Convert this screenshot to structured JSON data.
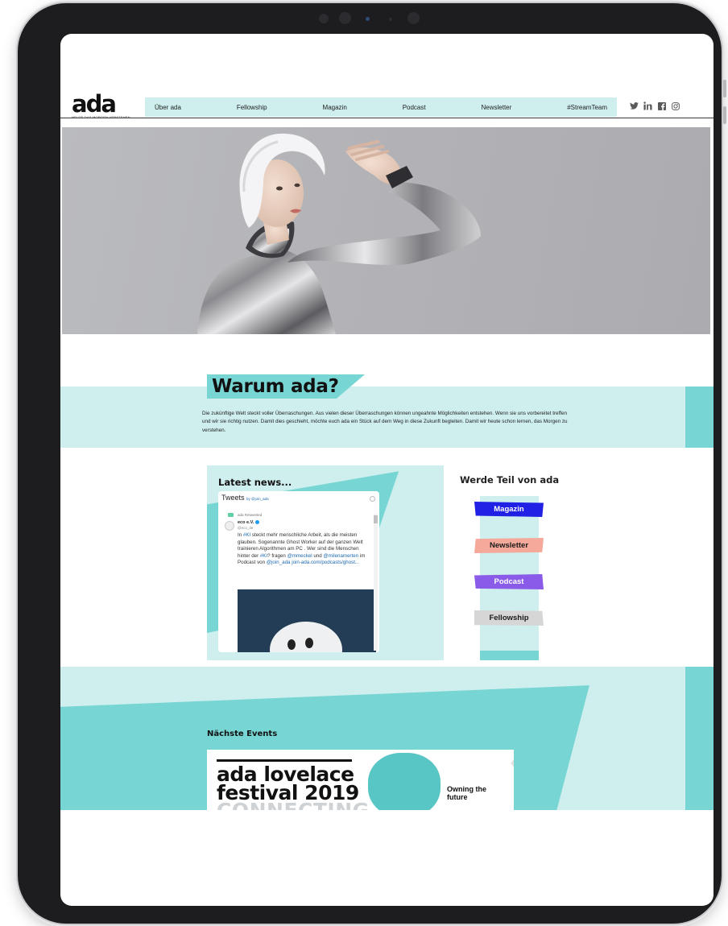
{
  "header": {
    "logo_word": "ada",
    "logo_tagline": "HEUTE DAS MORGEN VERSTEHEN",
    "nav": [
      "Über ada",
      "Fellowship",
      "Magazin",
      "Podcast",
      "Newsletter",
      "#StreamTeam"
    ],
    "social_icons": [
      "twitter-icon",
      "linkedin-icon",
      "facebook-icon",
      "instagram-icon"
    ]
  },
  "why": {
    "title": "Warum ada?",
    "text": "Die zukünftige Welt steckt voller Überraschungen. Aus vielen dieser Überraschungen können ungeahnte Möglichkeiten entstehen. Wenn sie uns vorbereitet treffen und wir sie richtig nutzen. Damit dies geschieht, möchte euch ada ein Stück auf dem Weg in diese Zukunft begleiten. Damit wir heute schon lernen, das Morgen zu verstehen."
  },
  "news": {
    "title": "Latest news...",
    "widget": {
      "heading": "Tweets",
      "by": "by @join_ada",
      "retweeted": "ada Retweeted",
      "author": "eco e.V.",
      "handle": "@eco_de",
      "body_parts": [
        {
          "t": "In ",
          "link": false
        },
        {
          "t": "#KI",
          "link": true
        },
        {
          "t": " steckt mehr menschliche Arbeit, als die meisten glauben. Sogenannte Ghost Worker auf der ganzen Welt trainieren Algorithmen am PC . Wer sind die Menschen hinter der ",
          "link": false
        },
        {
          "t": "#KI",
          "link": true
        },
        {
          "t": "? fragen ",
          "link": false
        },
        {
          "t": "@mmeckel",
          "link": true
        },
        {
          "t": " und ",
          "link": false
        },
        {
          "t": "@milenamerten",
          "link": true
        },
        {
          "t": " im Podcast von ",
          "link": false
        },
        {
          "t": "@join_ada",
          "link": true
        },
        {
          "t": " ",
          "link": false
        },
        {
          "t": "join-ada.com/podcasts/ghost...",
          "link": true
        }
      ]
    }
  },
  "join": {
    "title": "Werde Teil von ada",
    "buttons": [
      {
        "label": "Magazin",
        "bg": "#2121e6",
        "fg": "#ffffff"
      },
      {
        "label": "Newsletter",
        "bg": "#f4a99a",
        "fg": "#1a1a1a"
      },
      {
        "label": "Podcast",
        "bg": "#8a5ae8",
        "fg": "#ffffff"
      },
      {
        "label": "Fellowship",
        "bg": "#d6d6d6",
        "fg": "#1a1a1a"
      }
    ]
  },
  "events": {
    "title": "Nächste Events",
    "poster": {
      "line1": "ada lovelace",
      "line2": "festival 2019",
      "line3": "CONNECTING",
      "tagline": "Owning the future"
    }
  },
  "colors": {
    "teal_light": "#cfeeee",
    "teal": "#77d6d3"
  }
}
